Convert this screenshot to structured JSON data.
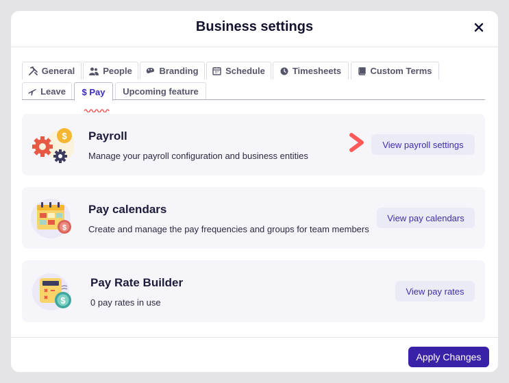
{
  "modal": {
    "title": "Business settings"
  },
  "tabs": [
    {
      "label": "General",
      "icon": "tools-icon"
    },
    {
      "label": "People",
      "icon": "people-icon"
    },
    {
      "label": "Branding",
      "icon": "palette-icon"
    },
    {
      "label": "Schedule",
      "icon": "calendar-icon"
    },
    {
      "label": "Timesheets",
      "icon": "clock-icon"
    },
    {
      "label": "Custom Terms",
      "icon": "book-icon"
    },
    {
      "label": "Leave",
      "icon": "plane-icon"
    },
    {
      "label": "$ Pay",
      "active": true
    },
    {
      "label": "Upcoming feature"
    }
  ],
  "cards": [
    {
      "title": "Payroll",
      "description": "Manage your payroll configuration and business entities",
      "button": "View payroll settings"
    },
    {
      "title": "Pay calendars",
      "description": "Create and manage the pay frequencies and groups for team members",
      "button": "View pay calendars"
    },
    {
      "title": "Pay Rate Builder",
      "description": "0 pay rates in use",
      "button": "View pay rates"
    }
  ],
  "footer": {
    "apply_label": "Apply Changes"
  },
  "colors": {
    "accent": "#3a21a8",
    "active_tab": "#3a2bbd",
    "pointer": "#ff5a5a",
    "button_bg": "#ebebf6"
  }
}
